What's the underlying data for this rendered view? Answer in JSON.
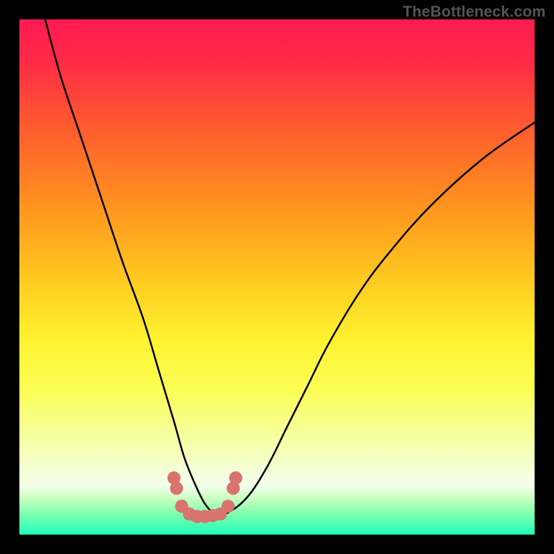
{
  "watermark": "TheBottleneck.com",
  "gradient_stops": [
    {
      "offset": 0.0,
      "color": "#ff1a52"
    },
    {
      "offset": 0.08,
      "color": "#ff2a47"
    },
    {
      "offset": 0.2,
      "color": "#ff5830"
    },
    {
      "offset": 0.35,
      "color": "#ff8f1f"
    },
    {
      "offset": 0.5,
      "color": "#ffc81f"
    },
    {
      "offset": 0.62,
      "color": "#fff22f"
    },
    {
      "offset": 0.72,
      "color": "#fbff55"
    },
    {
      "offset": 0.82,
      "color": "#f5ffa8"
    },
    {
      "offset": 0.88,
      "color": "#f5ffdb"
    },
    {
      "offset": 0.905,
      "color": "#f3ffea"
    },
    {
      "offset": 0.93,
      "color": "#c9ffbf"
    },
    {
      "offset": 0.96,
      "color": "#7dffb0"
    },
    {
      "offset": 1.0,
      "color": "#1fffba"
    }
  ],
  "chart_data": {
    "type": "line",
    "title": "",
    "xlabel": "",
    "ylabel": "",
    "xlim": [
      0,
      100
    ],
    "ylim": [
      0,
      100
    ],
    "series": [
      {
        "name": "curve",
        "x": [
          5,
          8,
          12,
          16,
          20,
          24,
          27,
          30,
          32,
          34,
          36,
          38,
          40,
          44,
          48,
          52,
          56,
          60,
          66,
          72,
          80,
          90,
          100
        ],
        "y": [
          100,
          89,
          77,
          65,
          53,
          42,
          32,
          22,
          15,
          10,
          6,
          4,
          4,
          7,
          13,
          21,
          29,
          37,
          47,
          55,
          64,
          73,
          80
        ]
      }
    ],
    "markers": {
      "name": "valley-dots",
      "color": "#d9736e",
      "points": [
        {
          "x": 30.0,
          "y": 11.0
        },
        {
          "x": 30.5,
          "y": 9.0
        },
        {
          "x": 31.5,
          "y": 5.5
        },
        {
          "x": 33.0,
          "y": 4.0
        },
        {
          "x": 34.5,
          "y": 3.5
        },
        {
          "x": 36.0,
          "y": 3.5
        },
        {
          "x": 37.5,
          "y": 3.7
        },
        {
          "x": 39.0,
          "y": 4.0
        },
        {
          "x": 40.5,
          "y": 5.5
        },
        {
          "x": 41.5,
          "y": 9.0
        },
        {
          "x": 42.0,
          "y": 11.0
        }
      ]
    }
  }
}
